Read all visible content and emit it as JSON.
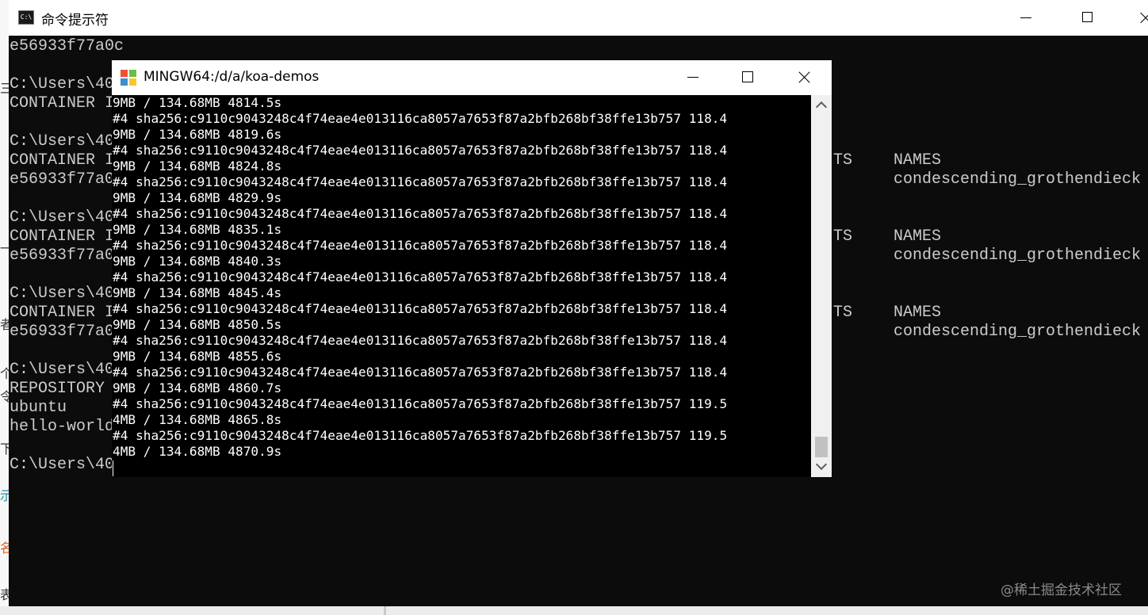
{
  "background": {
    "fragments": [
      "三",
      "一",
      "者",
      "个",
      "令",
      "下",
      "示",
      "名",
      "表"
    ],
    "colors": {
      "accent": "#1e90a0",
      "orange": "#e06020"
    }
  },
  "cmd": {
    "title": "命令提示符",
    "icon": "cmd-icon",
    "left_lines": [
      "e56933f77a0c",
      "C:\\Users\\40",
      "CONTAINER I",
      "C:\\Users\\40",
      "CONTAINER I",
      "e56933f77a0",
      "C:\\Users\\40",
      "CONTAINER I",
      "e56933f77a0",
      "C:\\Users\\40",
      "CONTAINER I",
      "e56933f77a0",
      "C:\\Users\\40",
      "REPOSITORY",
      "ubuntu",
      "hello-world",
      "C:\\Users\\40"
    ],
    "right_lines": [
      "TS",
      "NAMES",
      "condescending_grothendieck",
      "TS",
      "NAMES",
      "condescending_grothendieck",
      "TS",
      "NAMES",
      "condescending_grothendieck"
    ]
  },
  "mingw": {
    "title": "MINGW64:/d/a/koa-demos",
    "icon": "git-icon",
    "lines": [
      "9MB / 134.68MB 4814.5s",
      "#4 sha256:c9110c9043248c4f74eae4e013116ca8057a7653f87a2bfb268bf38ffe13b757 118.4",
      "9MB / 134.68MB 4819.6s",
      "#4 sha256:c9110c9043248c4f74eae4e013116ca8057a7653f87a2bfb268bf38ffe13b757 118.4",
      "9MB / 134.68MB 4824.8s",
      "#4 sha256:c9110c9043248c4f74eae4e013116ca8057a7653f87a2bfb268bf38ffe13b757 118.4",
      "9MB / 134.68MB 4829.9s",
      "#4 sha256:c9110c9043248c4f74eae4e013116ca8057a7653f87a2bfb268bf38ffe13b757 118.4",
      "9MB / 134.68MB 4835.1s",
      "#4 sha256:c9110c9043248c4f74eae4e013116ca8057a7653f87a2bfb268bf38ffe13b757 118.4",
      "9MB / 134.68MB 4840.3s",
      "#4 sha256:c9110c9043248c4f74eae4e013116ca8057a7653f87a2bfb268bf38ffe13b757 118.4",
      "9MB / 134.68MB 4845.4s",
      "#4 sha256:c9110c9043248c4f74eae4e013116ca8057a7653f87a2bfb268bf38ffe13b757 118.4",
      "9MB / 134.68MB 4850.5s",
      "#4 sha256:c9110c9043248c4f74eae4e013116ca8057a7653f87a2bfb268bf38ffe13b757 118.4",
      "9MB / 134.68MB 4855.6s",
      "#4 sha256:c9110c9043248c4f74eae4e013116ca8057a7653f87a2bfb268bf38ffe13b757 118.4",
      "9MB / 134.68MB 4860.7s",
      "#4 sha256:c9110c9043248c4f74eae4e013116ca8057a7653f87a2bfb268bf38ffe13b757 119.5",
      "4MB / 134.68MB 4865.8s",
      "#4 sha256:c9110c9043248c4f74eae4e013116ca8057a7653f87a2bfb268bf38ffe13b757 119.5",
      "4MB / 134.68MB 4870.9s"
    ]
  },
  "watermark": "@稀土掘金技术社区"
}
